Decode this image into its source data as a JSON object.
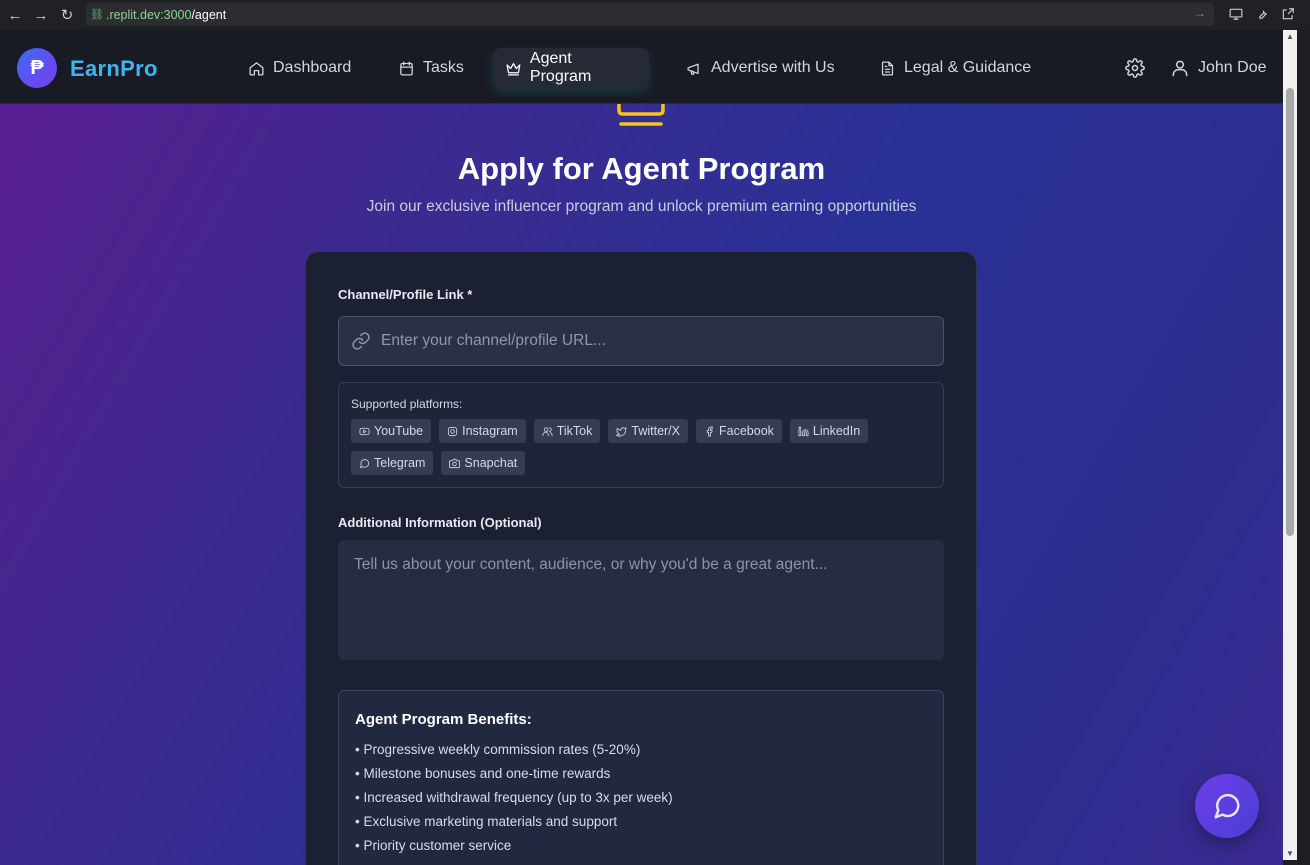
{
  "browser": {
    "url_host": ".replit.dev:3000",
    "url_path": "/agent"
  },
  "nav": {
    "brand": "EarnPro",
    "items": [
      {
        "label": "Dashboard",
        "icon": "home-icon"
      },
      {
        "label": "Tasks",
        "icon": "calendar-icon"
      },
      {
        "label": "Agent Program",
        "icon": "crown-icon",
        "active": true
      },
      {
        "label": "Advertise with Us",
        "icon": "megaphone-icon"
      },
      {
        "label": "Legal & Guidance",
        "icon": "document-icon"
      }
    ],
    "user_name": "John Doe"
  },
  "hero": {
    "title": "Apply for Agent Program",
    "subtitle": "Join our exclusive influencer program and unlock premium earning opportunities"
  },
  "form": {
    "link_label": "Channel/Profile Link *",
    "link_placeholder": "Enter your channel/profile URL...",
    "platforms_title": "Supported platforms:",
    "platforms": [
      "YouTube",
      "Instagram",
      "TikTok",
      "Twitter/X",
      "Facebook",
      "LinkedIn",
      "Telegram",
      "Snapchat"
    ],
    "info_label": "Additional Information (Optional)",
    "info_placeholder": "Tell us about your content, audience, or why you'd be a great agent..."
  },
  "benefits": {
    "title": "Agent Program Benefits:",
    "items": [
      "• Progressive weekly commission rates (5-20%)",
      "• Milestone bonuses and one-time rewards",
      "• Increased withdrawal frequency (up to 3x per week)",
      "• Exclusive marketing materials and support",
      "• Priority customer service"
    ]
  },
  "colors": {
    "brand": "#3fb5ef",
    "accent_crown": "#f5c518",
    "fab": "#5a3ee0"
  }
}
